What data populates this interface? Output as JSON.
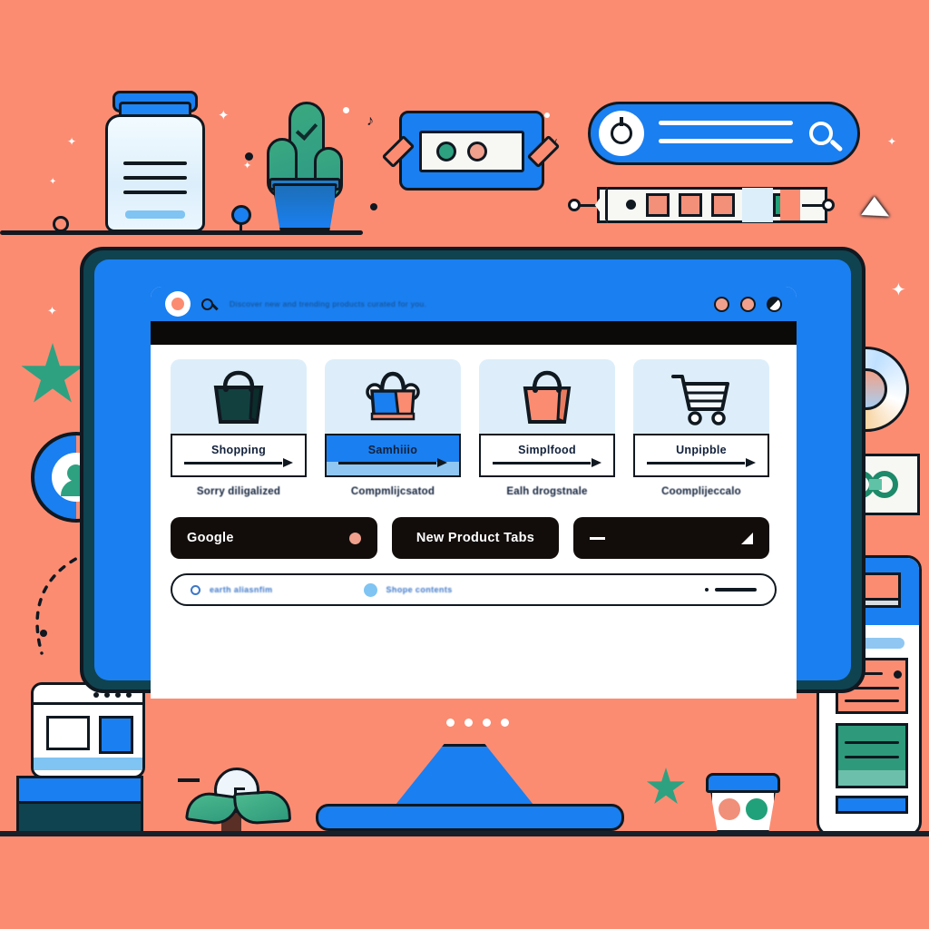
{
  "scene": {
    "background_color": "#FB8C72",
    "accent_blue": "#1A7FF0",
    "accent_green": "#2EA181",
    "accent_salmon": "#F0A08C",
    "outline": "#101820",
    "frame_teal": "#0F4350"
  },
  "browser": {
    "url_text": "Discover new and trending products curated for you.",
    "avatar_icon": "profile-dot-icon",
    "search_icon": "search-icon",
    "window_controls": [
      {
        "name": "minimize",
        "style": "salmon"
      },
      {
        "name": "maximize",
        "style": "salmon"
      },
      {
        "name": "close",
        "style": "split"
      }
    ]
  },
  "cards": [
    {
      "icon": "shopping-bag-icon",
      "button_label": "Shopping",
      "caption": "Sorry diligalized",
      "active": false,
      "bag_color": "#12403F"
    },
    {
      "icon": "shopping-bag-icon",
      "button_label": "Samhiiio",
      "caption": "Compmlijcsatod",
      "active": true,
      "bag_color": "#1A7FF0"
    },
    {
      "icon": "shopping-bag-icon",
      "button_label": "Simplfood",
      "caption": "Ealh drogstnale",
      "active": false,
      "bag_color": "#FB8C72"
    },
    {
      "icon": "shopping-cart-icon",
      "button_label": "Unpipble",
      "caption": "Coomplijeccalo",
      "active": false,
      "bag_color": "#FFFFFF"
    }
  ],
  "pills": [
    {
      "label": "Google",
      "trailing_icon": "dot-icon"
    },
    {
      "label": "New Product Tabs",
      "trailing_icon": "none"
    },
    {
      "label": "",
      "leading_icon": "dash-icon",
      "trailing_icon": "triangle-icon"
    }
  ],
  "bottom_bar": {
    "search_icon": "search-icon",
    "search_text": "earth aliasnfim",
    "status_icon": "blue-dot-icon",
    "status_text": "Shope contents",
    "right_icon": "menu-line-icon"
  },
  "decor": {
    "jar": {
      "name": "supplement-jar",
      "label_lines": 3
    },
    "cactus": {
      "name": "cactus-plant",
      "badge": "checkmark-icon"
    },
    "ticket": {
      "name": "ticket-card",
      "dots": [
        "#2EA181",
        "#F0A08C"
      ]
    },
    "top_search": {
      "name": "search-pill",
      "lines": 2,
      "icon": "search-icon"
    },
    "swatch_tag": {
      "name": "color-swatch-tag",
      "swatches": [
        "#F2907A",
        "#F2907A",
        "#F2907A",
        "#DCEEFA",
        "#21A179"
      ]
    },
    "star_left": "star-icon",
    "star_bottom": "star-icon",
    "avatar_badge": "user-avatar-icon",
    "ring": "gradient-ring-icon",
    "infinity_card": "infinity-link-icon",
    "phone": "phone-mockup",
    "mini_browser": "browser-window-mockup",
    "bulb_plant": "lightbulb-plant-icon",
    "cup": "cup-icon",
    "cursor": "cursor-arrow-icon",
    "bezel_dots": 4
  }
}
